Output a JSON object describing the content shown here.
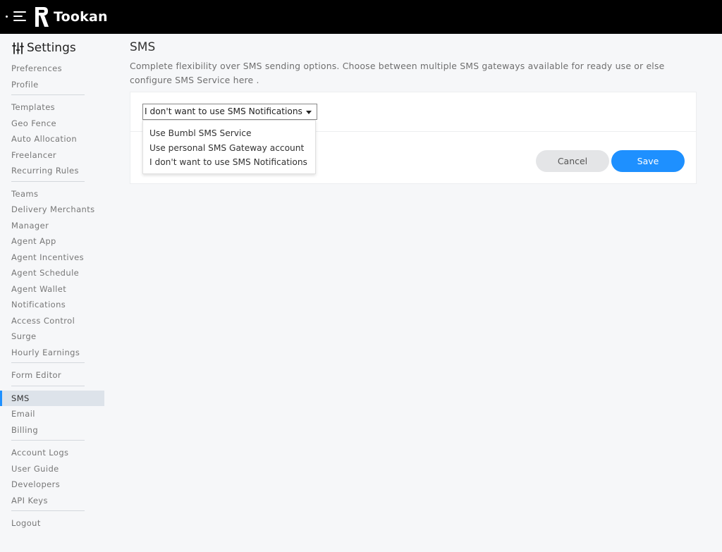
{
  "app": {
    "brand": "Tookan"
  },
  "sidebar": {
    "title": "Settings",
    "groups": [
      [
        {
          "label": "Preferences"
        },
        {
          "label": "Profile"
        }
      ],
      [
        {
          "label": "Templates"
        },
        {
          "label": "Geo Fence"
        },
        {
          "label": "Auto Allocation"
        },
        {
          "label": "Freelancer"
        },
        {
          "label": "Recurring Rules"
        }
      ],
      [
        {
          "label": "Teams"
        },
        {
          "label": "Delivery Merchants"
        },
        {
          "label": "Manager"
        },
        {
          "label": "Agent App"
        },
        {
          "label": "Agent Incentives"
        },
        {
          "label": "Agent Schedule"
        },
        {
          "label": "Agent Wallet"
        },
        {
          "label": "Notifications"
        },
        {
          "label": "Access Control"
        },
        {
          "label": "Surge"
        },
        {
          "label": "Hourly Earnings"
        }
      ],
      [
        {
          "label": "Form Editor"
        }
      ],
      [
        {
          "label": "SMS"
        },
        {
          "label": "Email"
        },
        {
          "label": "Billing"
        }
      ],
      [
        {
          "label": "Account Logs"
        },
        {
          "label": "User Guide"
        },
        {
          "label": "Developers"
        },
        {
          "label": "API Keys"
        }
      ],
      [
        {
          "label": "Logout"
        }
      ]
    ],
    "active": "SMS"
  },
  "main": {
    "title": "SMS",
    "description": "Complete flexibility over SMS sending options. Choose between multiple SMS gateways available for ready use or else configure SMS Service here .",
    "select": {
      "value": "I don't want to use SMS Notifications",
      "options": [
        "Use Bumbl SMS Service",
        "Use personal SMS Gateway account",
        "I don't want to use SMS Notifications"
      ]
    },
    "buttons": {
      "cancel": "Cancel",
      "save": "Save"
    }
  },
  "colors": {
    "accent": "#1e90ff",
    "topbar": "#000000",
    "active_bg": "#dde3ea"
  },
  "icons": {
    "menu": "hamburger-icon",
    "settings": "sliders-icon",
    "select_caret": "caret-down-icon"
  }
}
